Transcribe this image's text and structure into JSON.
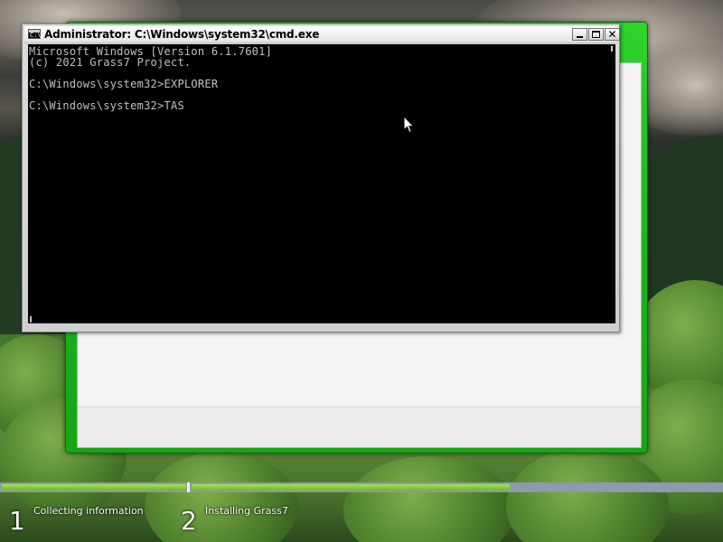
{
  "cmd_window": {
    "title": "Administrator: C:\\Windows\\system32\\cmd.exe",
    "icon_label": "C:\\",
    "console_lines": [
      "Microsoft Windows [Version 6.1.7601]",
      "(c) 2021 Grass7 Project.",
      "",
      "C:\\Windows\\system32>EXPLORER",
      "",
      "C:\\Windows\\system32>TAS"
    ],
    "colors": {
      "background": "#000000",
      "text": "#c0c0c0"
    }
  },
  "setup_window": {
    "accent_color": "#1fb81f"
  },
  "progress": {
    "steps": [
      {
        "number": "1",
        "label": "Collecting information",
        "fill_fraction": 1.0
      },
      {
        "number": "2",
        "label": "Installing Grass7",
        "fill_fraction": 0.6
      }
    ]
  },
  "icons": {
    "app": "console-icon",
    "minimize": "minimize-icon",
    "maximize": "maximize-icon",
    "close": "close-icon",
    "pointer": "mouse-pointer-icon"
  }
}
